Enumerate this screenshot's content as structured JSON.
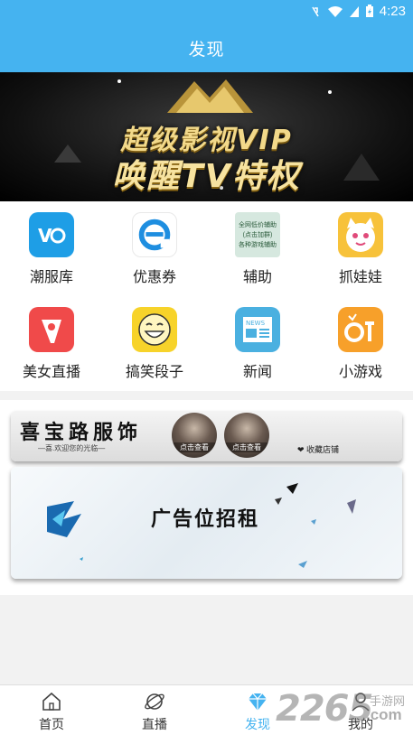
{
  "status_bar": {
    "time": "4:23"
  },
  "header": {
    "title": "发现"
  },
  "banner": {
    "line1": "超级影视VIP",
    "line2": "唤醒TV特权"
  },
  "grid": [
    {
      "label": "潮服库",
      "icon": "vcode-app-icon",
      "color": "#1e9ee6"
    },
    {
      "label": "优惠券",
      "icon": "coupon-e-icon",
      "color": "#1e8ee0"
    },
    {
      "label": "辅助",
      "icon": "helper-group-icon",
      "color": "#4a9a6a",
      "icon_text": [
        "全网低价辅助",
        "(点击加群)",
        "各种游戏辅助"
      ]
    },
    {
      "label": "抓娃娃",
      "icon": "cat-claw-icon",
      "color": "#f7c23a"
    },
    {
      "label": "美女直播",
      "icon": "live-stream-icon",
      "color": "#f04a4a"
    },
    {
      "label": "搞笑段子",
      "icon": "laughing-face-icon",
      "color": "#f7d32a"
    },
    {
      "label": "新闻",
      "icon": "news-icon",
      "color": "#4ab0e0",
      "icon_text": [
        "NEWS"
      ]
    },
    {
      "label": "小游戏",
      "icon": "mini-game-icon",
      "color": "#f7a02a"
    }
  ],
  "ads": {
    "shop_name": "喜宝路服饰",
    "shop_slogan": "—喜.欢迎您的光临—",
    "shop_button_1": "点击查看",
    "shop_button_2": "点击查看",
    "shop_fav": "❤ 收藏店铺",
    "ad_text": "广告位招租"
  },
  "bottom_nav": [
    {
      "label": "首页",
      "icon": "home-icon",
      "active": false
    },
    {
      "label": "直播",
      "icon": "planet-icon",
      "active": false
    },
    {
      "label": "发现",
      "icon": "diamond-icon",
      "active": true
    },
    {
      "label": "我的",
      "icon": "user-icon",
      "active": false
    }
  ],
  "watermark": {
    "number": "2265",
    "top": "手游网",
    "bottom": ".com"
  },
  "colors": {
    "primary": "#45b3f0",
    "active_nav": "#45b3f0",
    "banner_gold": "#f2d98a"
  }
}
